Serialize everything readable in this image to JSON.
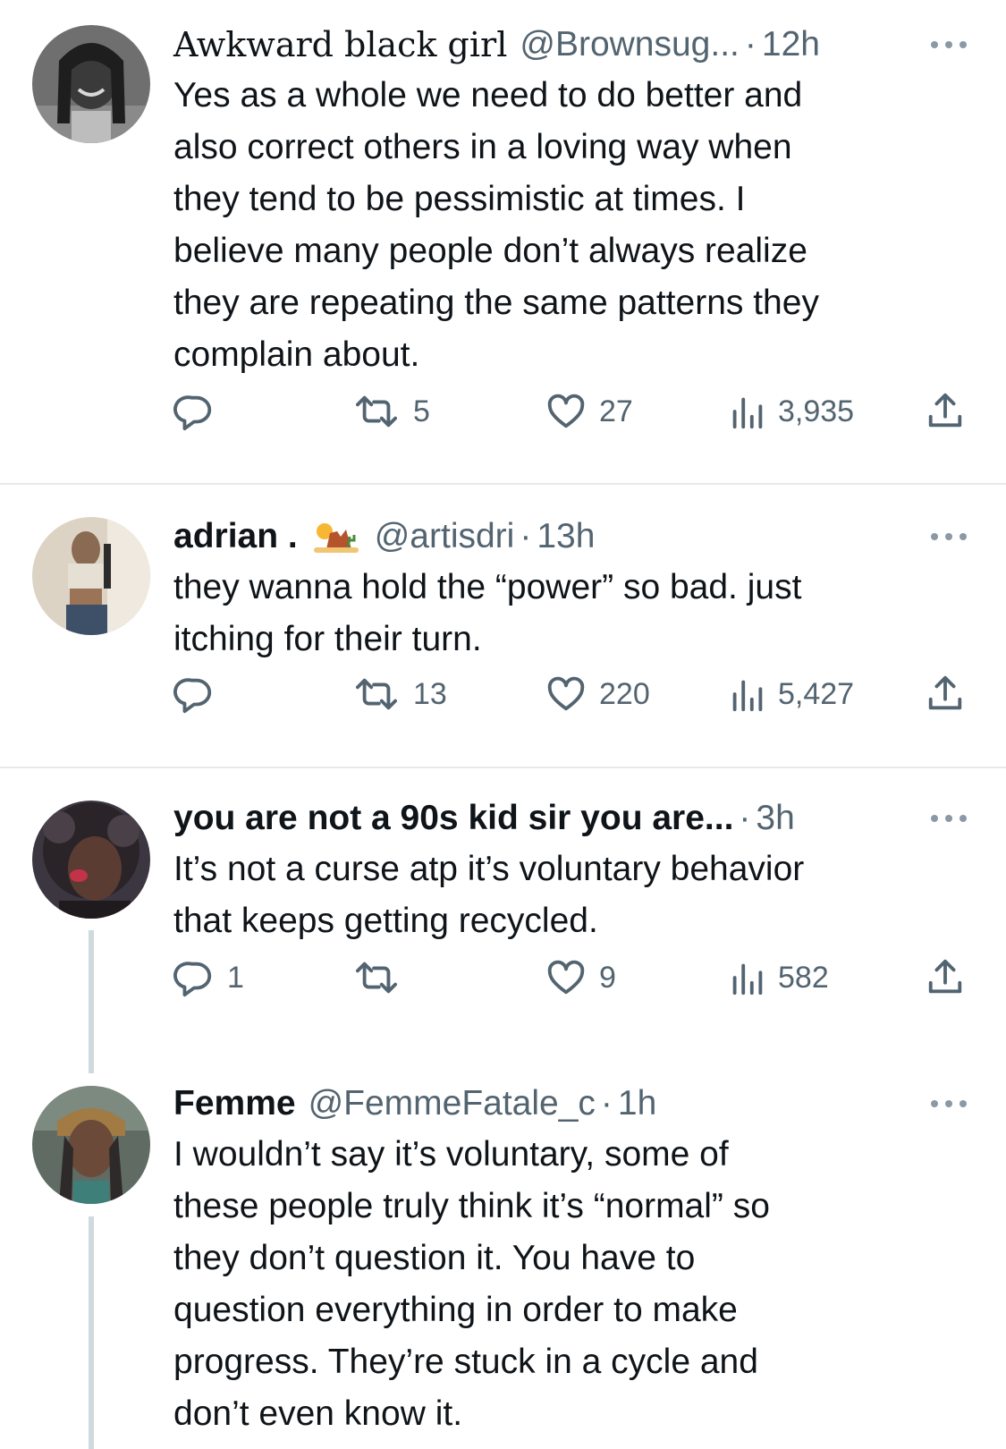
{
  "tweets": [
    {
      "name": "Awkward black girl",
      "handle": "@Brownsug...",
      "time": "12h",
      "text_lines": [
        "Yes as a whole we need to do better and",
        "also correct others in a loving way when",
        "they tend to be pessimistic at times. I",
        "believe many people don’t always realize",
        "they are repeating the same patterns they",
        "complain about."
      ],
      "replies": "",
      "retweets": "5",
      "likes": "27",
      "views": "3,935"
    },
    {
      "name": "adrian .",
      "handle": "@artisdri",
      "time": "13h",
      "text_lines": [
        "they wanna hold the “power” so bad. just",
        "itching for their turn."
      ],
      "replies": "",
      "retweets": "13",
      "likes": "220",
      "views": "5,427"
    },
    {
      "name": "you are not a 90s kid sir you are...",
      "handle": "",
      "time": "3h",
      "text_lines": [
        "It’s not a curse atp it’s voluntary behavior",
        "that keeps getting recycled."
      ],
      "replies": "1",
      "retweets": "",
      "likes": "9",
      "views": "582"
    },
    {
      "name": "Femme",
      "handle": "@FemmeFatale_c",
      "time": "1h",
      "text_lines": [
        "I wouldn’t say it’s voluntary, some of",
        "these people truly think it’s “normal” so",
        "they don’t question it. You have to",
        "question everything in order to make",
        "progress. They’re stuck in a cycle and",
        "don’t even know it."
      ]
    }
  ],
  "separator": "·",
  "icons": {
    "reply": "reply-icon",
    "retweet": "retweet-icon",
    "like": "like-icon",
    "views": "views-icon",
    "share": "share-icon",
    "more": "more-icon",
    "desert_emoji": "desert-emoji-icon"
  },
  "colors": {
    "text": "#0f1419",
    "secondary": "#536471",
    "divider": "#e6e9eb",
    "thread_line": "#cfd9de"
  }
}
